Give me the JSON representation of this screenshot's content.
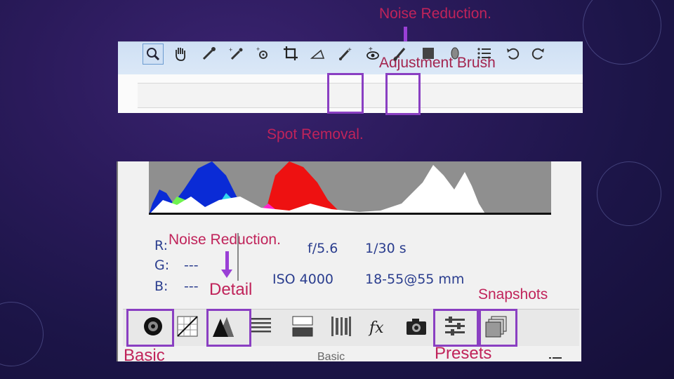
{
  "callouts": {
    "noise_reduction_top": "Noise Reduction.",
    "adjustment_brush": "Adjustment Brush",
    "spot_removal": "Spot Removal.",
    "noise_reduction_mid": "Noise Reduction.",
    "detail": "Detail",
    "snapshots": "Snapshots",
    "basic": "Basic",
    "presets": "Presets"
  },
  "camera_info": {
    "r_label": "R:",
    "g_label": "G:",
    "b_label": "B:",
    "g_value": "---",
    "b_value": "---",
    "aperture": "f/5.6",
    "shutter": "1/30 s",
    "iso": "ISO 4000",
    "lens": "18-55@55 mm"
  },
  "panel": {
    "section_title": "Basic"
  },
  "toolbar": {
    "tools": [
      "zoom-tool",
      "hand-tool",
      "white-balance-tool",
      "color-sampler-tool",
      "targeted-adjustment-tool",
      "crop-tool",
      "straighten-tool",
      "spot-removal-tool",
      "red-eye-removal-tool",
      "adjustment-brush-tool",
      "graduated-filter-tool",
      "radial-filter-tool",
      "preferences-tool",
      "rotate-left-tool",
      "rotate-right-tool"
    ]
  },
  "tabs": [
    "basic-tab",
    "tone-curve-tab",
    "detail-tab",
    "hsl-tab",
    "split-toning-tab",
    "lens-corrections-tab",
    "effects-tab",
    "camera-calibration-tab",
    "presets-tab",
    "snapshots-tab"
  ],
  "colors": {
    "highlight": "#8a3fc2",
    "callout_text": "#c0235a",
    "arrow": "#9a3fd6"
  }
}
